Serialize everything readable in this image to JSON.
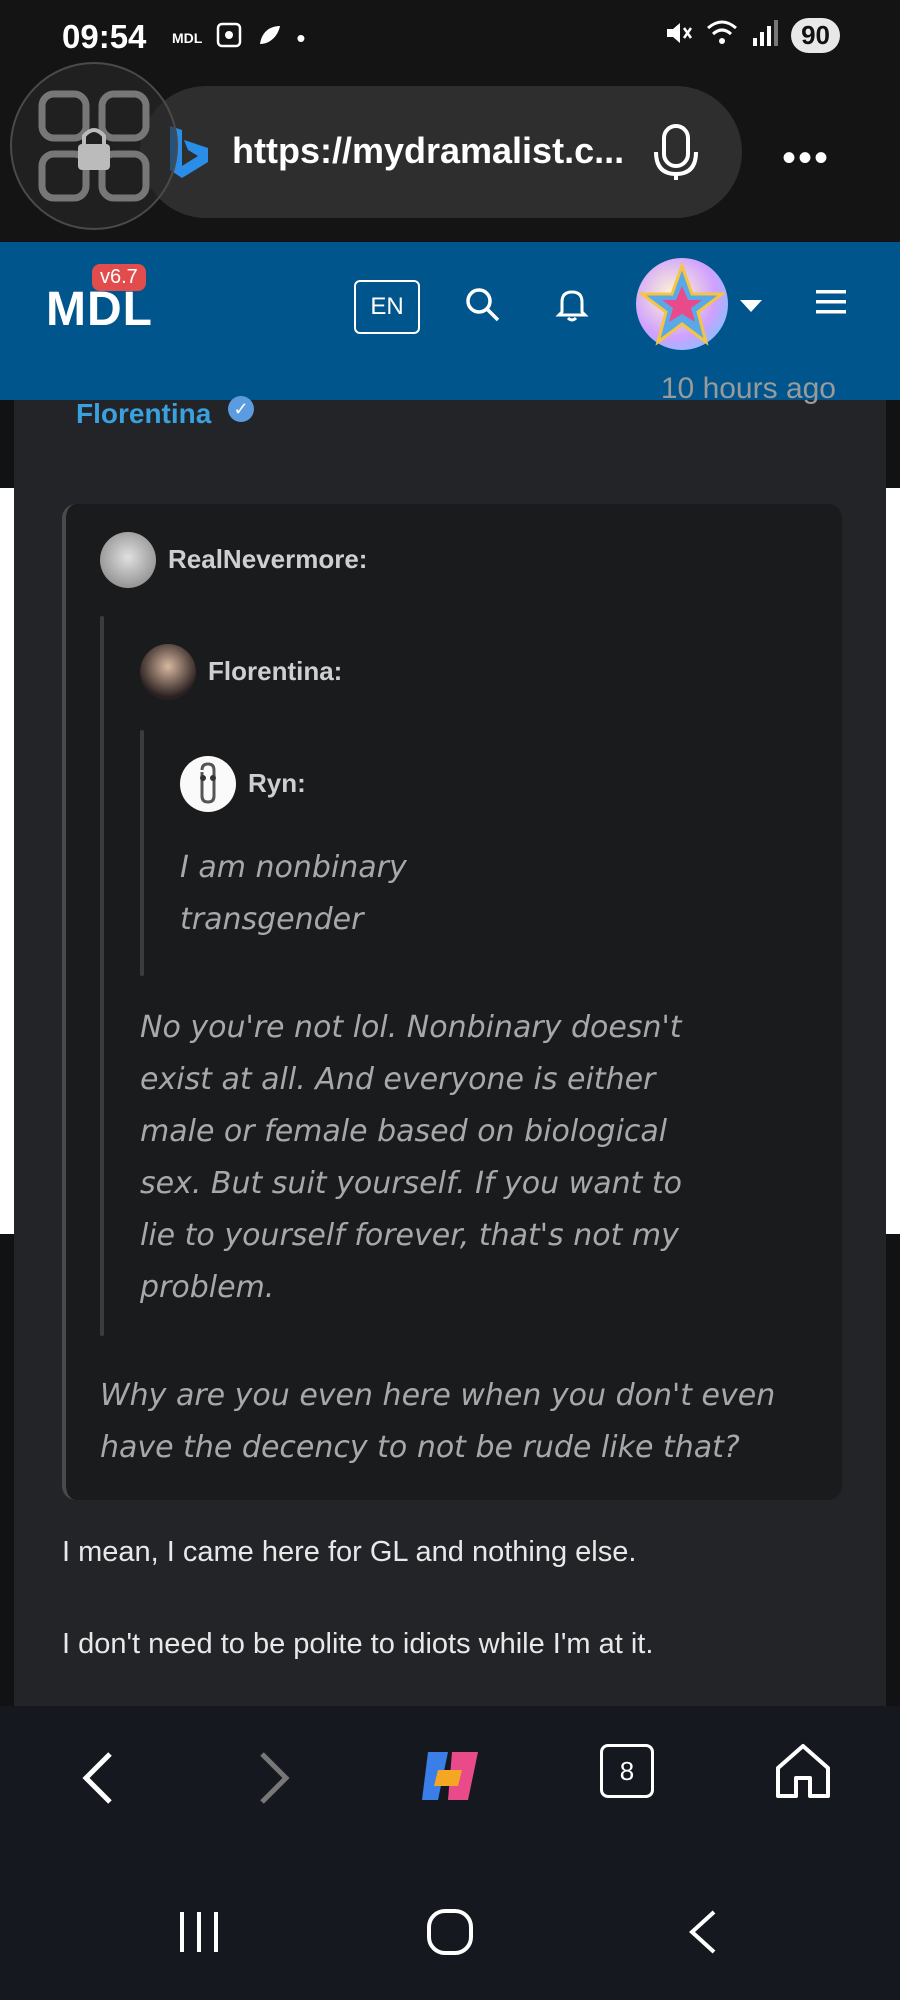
{
  "status_bar": {
    "time": "09:54",
    "carrier_label": "MDL",
    "battery": "90"
  },
  "browser": {
    "url": "https://mydramalist.c...",
    "more_label": "•••"
  },
  "site_header": {
    "logo": "MDL",
    "version": "v6.7",
    "language": "EN"
  },
  "comment": {
    "author": "Florentina",
    "time_ago": "10 hours ago",
    "quote": {
      "author": "RealNevermore:",
      "nested": {
        "author": "Florentina:",
        "nested": {
          "author": "Ryn:",
          "lines": [
            "I am nonbinary",
            "transgender"
          ]
        },
        "lines": [
          "No you're not lol. Nonbinary doesn't",
          "exist at all. And everyone is either",
          "male or female based on biological",
          "sex. But suit yourself. If you want to",
          "lie to yourself forever, that's not my",
          "problem."
        ]
      },
      "lines": [
        "Why are you even here when you don't even",
        "have the decency to not be rude like that?"
      ]
    },
    "reply": [
      "I mean, I came here for GL and nothing else.",
      "I don't need to be polite to idiots while I'm at it."
    ]
  },
  "bottom_nav": {
    "tab_count": "8"
  },
  "colors": {
    "header_blue": "#00558c",
    "author_blue": "#3aa0de",
    "badge_red": "#e24c4c"
  }
}
